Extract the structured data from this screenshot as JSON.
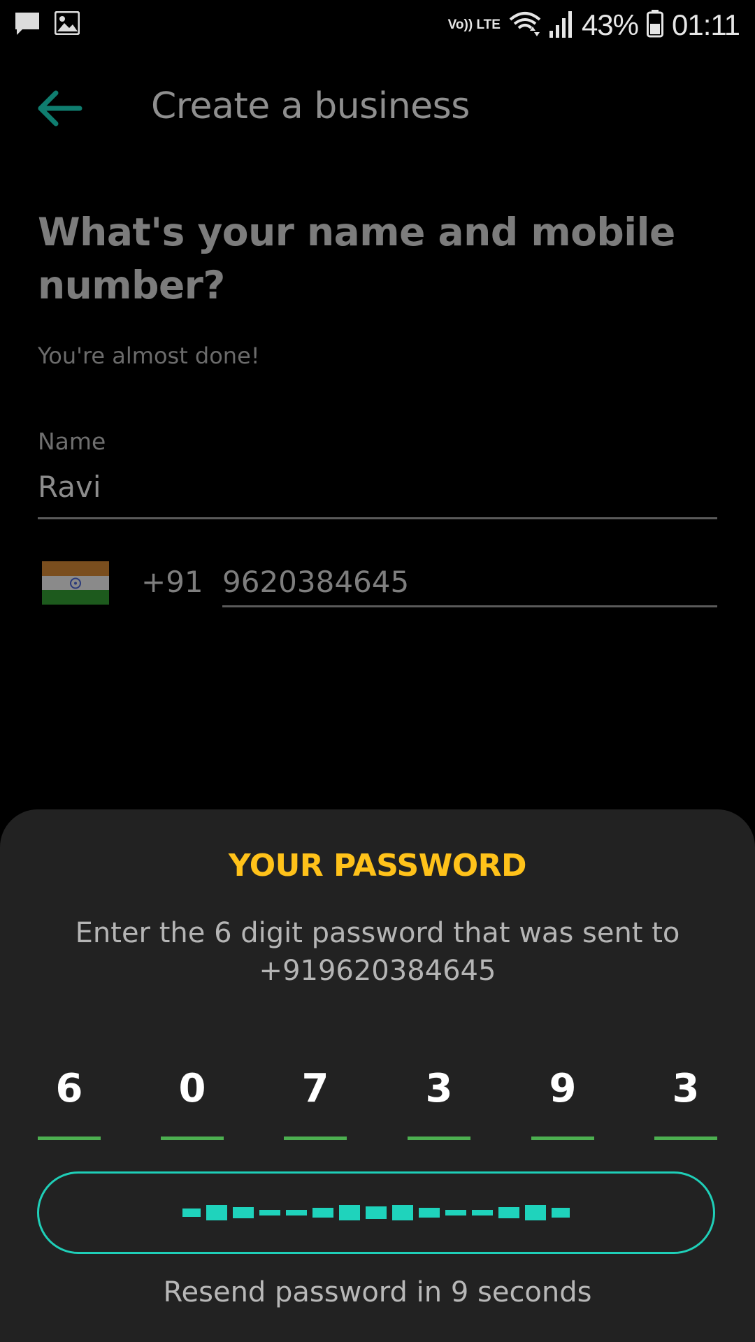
{
  "status_bar": {
    "network_label": "Vo)) LTE",
    "battery": "43%",
    "time": "01:11"
  },
  "header": {
    "title": "Create a business"
  },
  "form": {
    "question": "What's your name and mobile number?",
    "subtitle": "You're almost done!",
    "name_label": "Name",
    "name_value": "Ravi",
    "country_code": "+91",
    "phone_value": "9620384645"
  },
  "sheet": {
    "title": "YOUR PASSWORD",
    "description": "Enter the 6 digit password that was sent to +919620384645",
    "digits": [
      "6",
      "0",
      "7",
      "3",
      "9",
      "3"
    ],
    "resend_text": "Resend password in 9 seconds"
  },
  "colors": {
    "accent": "#1fcfb8",
    "title_yellow": "#ffc21a",
    "digit_underline": "#4caf50",
    "sheet_bg": "#222222"
  }
}
